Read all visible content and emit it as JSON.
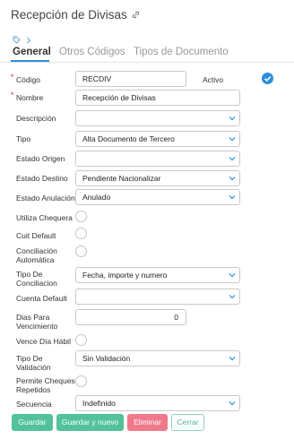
{
  "header": {
    "title": "Recepción de Divisas"
  },
  "tabs": [
    {
      "label": "General",
      "active": true
    },
    {
      "label": "Otros Códigos",
      "active": false
    },
    {
      "label": "Tipos de Documento",
      "active": false
    }
  ],
  "fields": {
    "codigo": {
      "label": "Código",
      "value": "RECDIV",
      "required": true
    },
    "activo": {
      "label": "Activo",
      "checked": true
    },
    "nombre": {
      "label": "Nombre",
      "value": "Recepción de Divisas",
      "required": true
    },
    "descripcion": {
      "label": "Descripción",
      "value": ""
    },
    "tipo": {
      "label": "Tipo",
      "value": "Alta Documento de Tercero"
    },
    "estado_origen": {
      "label": "Estado Origen",
      "value": ""
    },
    "estado_destino": {
      "label": "Estado Destino",
      "value": "Pendiente Nacionalizar"
    },
    "estado_anulacion": {
      "label": "Estado Anulación",
      "value": "Anulado"
    },
    "utiliza_chequera": {
      "label": "Utiliza Chequera",
      "checked": false
    },
    "cuit_default": {
      "label": "Cuit Default",
      "checked": false
    },
    "conciliacion_automatica": {
      "label_line1": "Conciliación",
      "label_line2": "Automática",
      "checked": false
    },
    "tipo_conciliacion": {
      "label_line1": "Tipo De",
      "label_line2": "Conciliacion",
      "value": "Fecha, importe y numero"
    },
    "cuenta_default": {
      "label": "Cuenta Default",
      "value": ""
    },
    "dias_vencimiento": {
      "label_line1": "Dias Para",
      "label_line2": "Vencimiento",
      "value": "0"
    },
    "vence_dia_habil": {
      "label": "Vence Día Hábil",
      "checked": false
    },
    "tipo_validacion": {
      "label_line1": "Tipo De",
      "label_line2": "Validación",
      "value": "Sin Validación"
    },
    "permite_cheques_repetidos": {
      "label_line1": "Permite Cheques",
      "label_line2": "Repetidos",
      "checked": false
    },
    "secuencia": {
      "label": "Secuencia",
      "value": "Indefinido"
    }
  },
  "buttons": {
    "guardar": "Guardar",
    "guardar_nuevo": "Guardar y nuevo",
    "eliminar": "Eliminar",
    "cerrar": "Cerrar"
  },
  "colors": {
    "accent": "#2a8fd8",
    "success": "#52c29a",
    "danger": "#f07a8c",
    "required": "#e0303a"
  }
}
